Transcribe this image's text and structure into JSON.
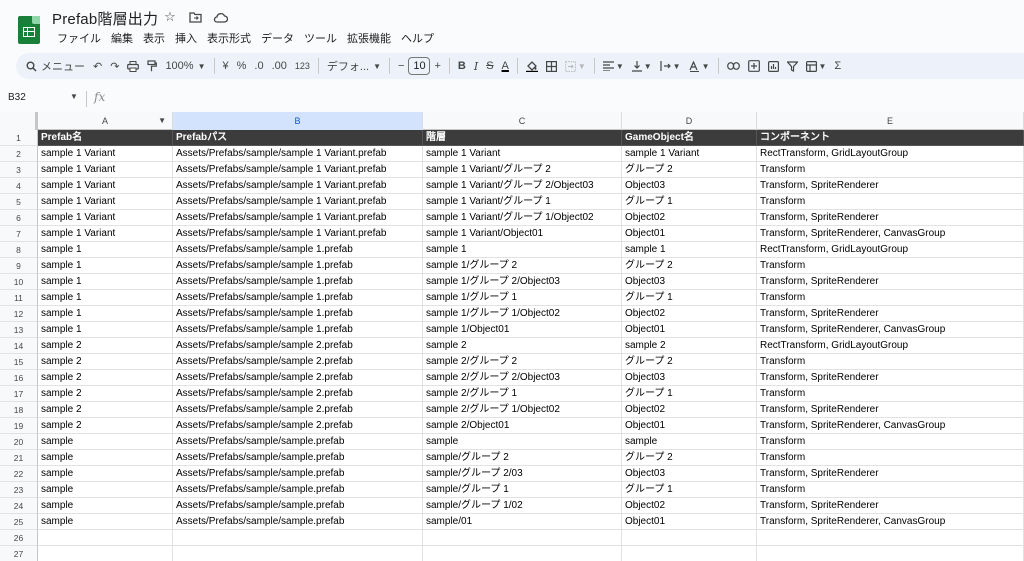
{
  "app": {
    "title": "Prefab階層出力",
    "title_icons": [
      "star-icon",
      "folder-move-icon",
      "cloud-status-icon"
    ],
    "menu": [
      "ファイル",
      "編集",
      "表示",
      "挿入",
      "表示形式",
      "データ",
      "ツール",
      "拡張機能",
      "ヘルプ"
    ]
  },
  "toolbar": {
    "search_label": "メニュー",
    "zoom": "100%",
    "currency": "¥",
    "percent": "%",
    "dec_decrease": ".0",
    "dec_increase": ".00",
    "number_format": "123",
    "font": "デフォ...",
    "font_size": "10",
    "minus": "−",
    "plus": "+",
    "bold": "B",
    "italic": "I",
    "strike": "S",
    "text_color": "A"
  },
  "formula_bar": {
    "cell_ref": "B32",
    "fx": "fx",
    "value": ""
  },
  "columns": [
    "A",
    "B",
    "C",
    "D",
    "E"
  ],
  "selected_column": "B",
  "header": [
    "Prefab名",
    "Prefabパス",
    "階層",
    "GameObject名",
    "コンポーネント"
  ],
  "rows": [
    [
      "sample 1 Variant",
      "Assets/Prefabs/sample/sample 1 Variant.prefab",
      "sample 1 Variant",
      "sample 1 Variant",
      "RectTransform, GridLayoutGroup"
    ],
    [
      "sample 1 Variant",
      "Assets/Prefabs/sample/sample 1 Variant.prefab",
      "sample 1 Variant/グループ 2",
      "グループ 2",
      "Transform"
    ],
    [
      "sample 1 Variant",
      "Assets/Prefabs/sample/sample 1 Variant.prefab",
      "sample 1 Variant/グループ 2/Object03",
      "Object03",
      "Transform, SpriteRenderer"
    ],
    [
      "sample 1 Variant",
      "Assets/Prefabs/sample/sample 1 Variant.prefab",
      "sample 1 Variant/グループ 1",
      "グループ 1",
      "Transform"
    ],
    [
      "sample 1 Variant",
      "Assets/Prefabs/sample/sample 1 Variant.prefab",
      "sample 1 Variant/グループ 1/Object02",
      "Object02",
      "Transform, SpriteRenderer"
    ],
    [
      "sample 1 Variant",
      "Assets/Prefabs/sample/sample 1 Variant.prefab",
      "sample 1 Variant/Object01",
      "Object01",
      "Transform, SpriteRenderer, CanvasGroup"
    ],
    [
      "sample 1",
      "Assets/Prefabs/sample/sample 1.prefab",
      "sample 1",
      "sample 1",
      "RectTransform, GridLayoutGroup"
    ],
    [
      "sample 1",
      "Assets/Prefabs/sample/sample 1.prefab",
      "sample 1/グループ 2",
      "グループ 2",
      "Transform"
    ],
    [
      "sample 1",
      "Assets/Prefabs/sample/sample 1.prefab",
      "sample 1/グループ 2/Object03",
      "Object03",
      "Transform, SpriteRenderer"
    ],
    [
      "sample 1",
      "Assets/Prefabs/sample/sample 1.prefab",
      "sample 1/グループ 1",
      "グループ 1",
      "Transform"
    ],
    [
      "sample 1",
      "Assets/Prefabs/sample/sample 1.prefab",
      "sample 1/グループ 1/Object02",
      "Object02",
      "Transform, SpriteRenderer"
    ],
    [
      "sample 1",
      "Assets/Prefabs/sample/sample 1.prefab",
      "sample 1/Object01",
      "Object01",
      "Transform, SpriteRenderer, CanvasGroup"
    ],
    [
      "sample 2",
      "Assets/Prefabs/sample/sample 2.prefab",
      "sample 2",
      "sample 2",
      "RectTransform, GridLayoutGroup"
    ],
    [
      "sample 2",
      "Assets/Prefabs/sample/sample 2.prefab",
      "sample 2/グループ 2",
      "グループ 2",
      "Transform"
    ],
    [
      "sample 2",
      "Assets/Prefabs/sample/sample 2.prefab",
      "sample 2/グループ 2/Object03",
      "Object03",
      "Transform, SpriteRenderer"
    ],
    [
      "sample 2",
      "Assets/Prefabs/sample/sample 2.prefab",
      "sample 2/グループ 1",
      "グループ 1",
      "Transform"
    ],
    [
      "sample 2",
      "Assets/Prefabs/sample/sample 2.prefab",
      "sample 2/グループ 1/Object02",
      "Object02",
      "Transform, SpriteRenderer"
    ],
    [
      "sample 2",
      "Assets/Prefabs/sample/sample 2.prefab",
      "sample 2/Object01",
      "Object01",
      "Transform, SpriteRenderer, CanvasGroup"
    ],
    [
      "sample",
      "Assets/Prefabs/sample/sample.prefab",
      "sample",
      "sample",
      "Transform"
    ],
    [
      "sample",
      "Assets/Prefabs/sample/sample.prefab",
      "sample/グループ 2",
      "グループ 2",
      "Transform"
    ],
    [
      "sample",
      "Assets/Prefabs/sample/sample.prefab",
      "sample/グループ 2/03",
      "Object03",
      "Transform, SpriteRenderer"
    ],
    [
      "sample",
      "Assets/Prefabs/sample/sample.prefab",
      "sample/グループ 1",
      "グループ 1",
      "Transform"
    ],
    [
      "sample",
      "Assets/Prefabs/sample/sample.prefab",
      "sample/グループ 1/02",
      "Object02",
      "Transform, SpriteRenderer"
    ],
    [
      "sample",
      "Assets/Prefabs/sample/sample.prefab",
      "sample/01",
      "Object01",
      "Transform, SpriteRenderer, CanvasGroup"
    ],
    [
      "",
      "",
      "",
      "",
      ""
    ],
    [
      "",
      "",
      "",
      "",
      ""
    ]
  ],
  "row_numbers": [
    "1",
    "2",
    "3",
    "4",
    "5",
    "6",
    "7",
    "8",
    "9",
    "10",
    "11",
    "12",
    "13",
    "14",
    "15",
    "16",
    "17",
    "18",
    "19",
    "20",
    "21",
    "22",
    "23",
    "24",
    "25",
    "26",
    "27"
  ],
  "colors": {
    "header_bg": "#3c3c3c",
    "selected_col": "#d3e3fd",
    "logo": "#188038"
  }
}
